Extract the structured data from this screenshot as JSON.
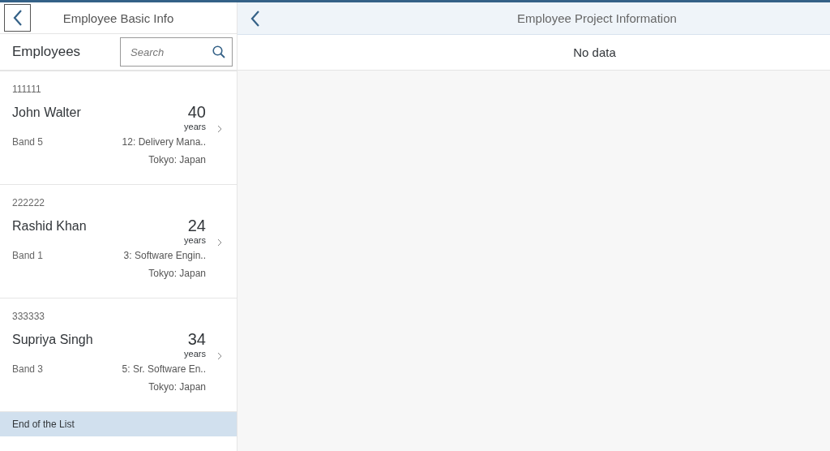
{
  "master": {
    "title": "Employee Basic Info",
    "list_title": "Employees",
    "search": {
      "placeholder": "Search"
    },
    "employees": [
      {
        "id": "111111",
        "name": "John Walter",
        "age": "40",
        "age_unit": "years",
        "band": "Band 5",
        "role": "12: Delivery Mana..",
        "location": "Tokyo: Japan"
      },
      {
        "id": "222222",
        "name": "Rashid Khan",
        "age": "24",
        "age_unit": "years",
        "band": "Band 1",
        "role": "3: Software Engin..",
        "location": "Tokyo: Japan"
      },
      {
        "id": "333333",
        "name": "Supriya Singh",
        "age": "34",
        "age_unit": "years",
        "band": "Band 3",
        "role": "5: Sr. Software En..",
        "location": "Tokyo: Japan"
      }
    ],
    "end_text": "End of the List"
  },
  "detail": {
    "title": "Employee Project Information",
    "empty_text": "No data"
  }
}
